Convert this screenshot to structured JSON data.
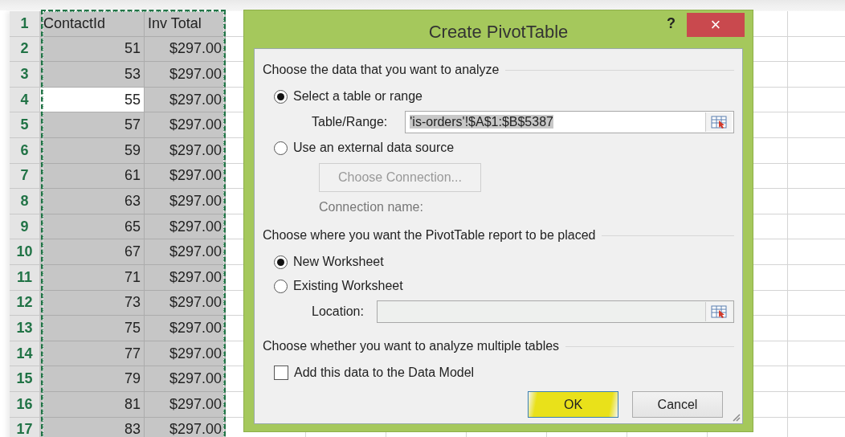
{
  "sheet": {
    "rows": [
      {
        "number": "1",
        "kind": "header",
        "active": false,
        "cells": [
          "ContactId",
          "Inv Total"
        ]
      },
      {
        "number": "2",
        "kind": "data",
        "active": false,
        "cells": [
          "51",
          "$297.00"
        ]
      },
      {
        "number": "3",
        "kind": "data",
        "active": false,
        "cells": [
          "53",
          "$297.00"
        ]
      },
      {
        "number": "4",
        "kind": "data",
        "active": true,
        "cells": [
          "55",
          "$297.00"
        ]
      },
      {
        "number": "5",
        "kind": "data",
        "active": false,
        "cells": [
          "57",
          "$297.00"
        ]
      },
      {
        "number": "6",
        "kind": "data",
        "active": false,
        "cells": [
          "59",
          "$297.00"
        ]
      },
      {
        "number": "7",
        "kind": "data",
        "active": false,
        "cells": [
          "61",
          "$297.00"
        ]
      },
      {
        "number": "8",
        "kind": "data",
        "active": false,
        "cells": [
          "63",
          "$297.00"
        ]
      },
      {
        "number": "9",
        "kind": "data",
        "active": false,
        "cells": [
          "65",
          "$297.00"
        ]
      },
      {
        "number": "10",
        "kind": "data",
        "active": false,
        "cells": [
          "67",
          "$297.00"
        ]
      },
      {
        "number": "11",
        "kind": "data",
        "active": false,
        "cells": [
          "71",
          "$297.00"
        ]
      },
      {
        "number": "12",
        "kind": "data",
        "active": false,
        "cells": [
          "73",
          "$297.00"
        ]
      },
      {
        "number": "13",
        "kind": "data",
        "active": false,
        "cells": [
          "75",
          "$297.00"
        ]
      },
      {
        "number": "14",
        "kind": "data",
        "active": false,
        "cells": [
          "77",
          "$297.00"
        ]
      },
      {
        "number": "15",
        "kind": "data",
        "active": false,
        "cells": [
          "79",
          "$297.00"
        ]
      },
      {
        "number": "16",
        "kind": "data",
        "active": false,
        "cells": [
          "81",
          "$297.00"
        ]
      },
      {
        "number": "17",
        "kind": "data",
        "active": false,
        "cells": [
          "83",
          "$297.00"
        ]
      }
    ]
  },
  "dialog": {
    "title": "Create PivotTable",
    "help": "?",
    "close": "×",
    "data_section": {
      "heading": "Choose the data that you want to analyze",
      "options": [
        {
          "label": "Select a table or range",
          "selected": true
        },
        {
          "label": "Use an external data source",
          "selected": false
        }
      ],
      "range_field": {
        "label": "Table/Range:",
        "value": "'is-orders'!$A$1:$B$5387",
        "value_selected": true,
        "disabled": false
      },
      "connection_button": {
        "label": "Choose Connection...",
        "disabled": true
      },
      "connection_name_label": "Connection name:"
    },
    "placement_section": {
      "heading": "Choose where you want the PivotTable report to be placed",
      "options": [
        {
          "label": "New Worksheet",
          "selected": true
        },
        {
          "label": "Existing Worksheet",
          "selected": false
        }
      ],
      "location_field": {
        "label": "Location:",
        "disabled": true
      }
    },
    "model_section": {
      "heading": "Choose whether you want to analyze multiple tables",
      "checkbox": {
        "label": "Add this data to the Data Model",
        "checked": false
      }
    },
    "buttons": [
      {
        "label": "OK",
        "default": true,
        "highlighted": true
      },
      {
        "label": "Cancel",
        "default": false,
        "highlighted": false
      }
    ]
  }
}
